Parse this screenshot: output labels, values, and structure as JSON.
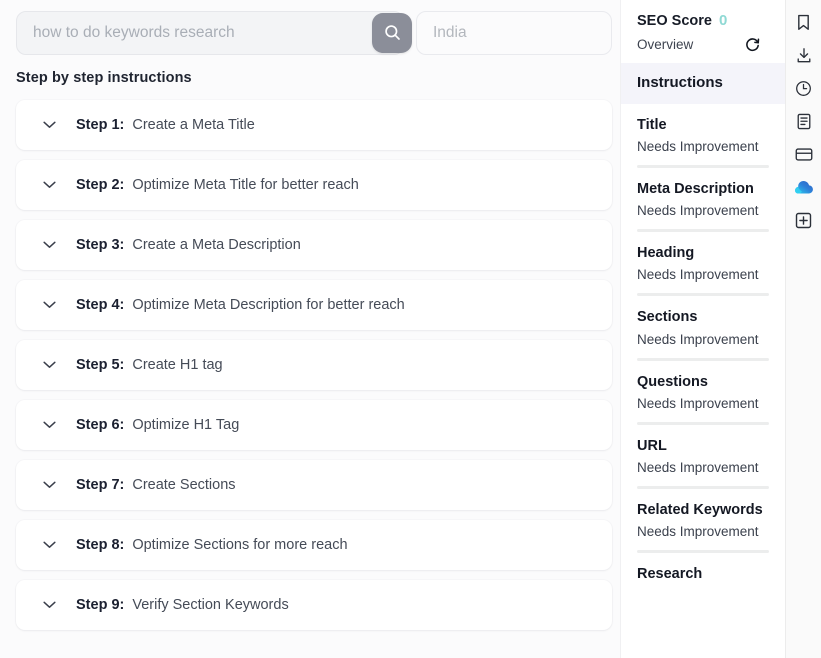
{
  "search": {
    "keyword_placeholder": "how to do keywords research",
    "keyword_value": "",
    "country_placeholder": "India",
    "country_value": "",
    "search_icon": "search-icon",
    "search_button_color": "#8b8e99"
  },
  "main": {
    "section_title": "Step by step instructions",
    "chevron_icon": "chevron-down-icon",
    "steps": [
      {
        "label": "Step 1:",
        "text": "Create a Meta Title"
      },
      {
        "label": "Step 2:",
        "text": "Optimize Meta Title for better reach"
      },
      {
        "label": "Step 3:",
        "text": "Create a Meta Description"
      },
      {
        "label": "Step 4:",
        "text": "Optimize Meta Description for better reach"
      },
      {
        "label": "Step 5:",
        "text": "Create H1 tag"
      },
      {
        "label": "Step 6:",
        "text": "Optimize H1 Tag"
      },
      {
        "label": "Step 7:",
        "text": "Create Sections"
      },
      {
        "label": "Step 8:",
        "text": "Optimize Sections for more reach"
      },
      {
        "label": "Step 9:",
        "text": "Verify Section Keywords"
      }
    ]
  },
  "panel": {
    "seo_score_label": "SEO Score",
    "seo_score_value": "0",
    "seo_score_color": "#8fd9d4",
    "overview_label": "Overview",
    "refresh_icon": "refresh-icon",
    "active_item": "Instructions",
    "active_bg_color": "#f4f4fa",
    "metrics": [
      {
        "name": "Title",
        "status": "Needs Improvement"
      },
      {
        "name": "Meta Description",
        "status": "Needs Improvement"
      },
      {
        "name": "Heading",
        "status": "Needs Improvement"
      },
      {
        "name": "Sections",
        "status": "Needs Improvement"
      },
      {
        "name": "Questions",
        "status": "Needs Improvement"
      },
      {
        "name": "URL",
        "status": "Needs Improvement"
      },
      {
        "name": "Related Keywords",
        "status": "Needs Improvement"
      },
      {
        "name": "Research",
        "status": ""
      }
    ]
  },
  "rail": {
    "icons": [
      "bookmark-icon",
      "download-icon",
      "history-clock-icon",
      "document-icon",
      "wallet-card-icon",
      "cloud-drive-icon",
      "add-box-icon"
    ],
    "cloud_icon_colors": [
      "#2dc8f0",
      "#2f6fd0"
    ]
  },
  "cursor": {
    "type": "pointer-hand-cursor"
  }
}
